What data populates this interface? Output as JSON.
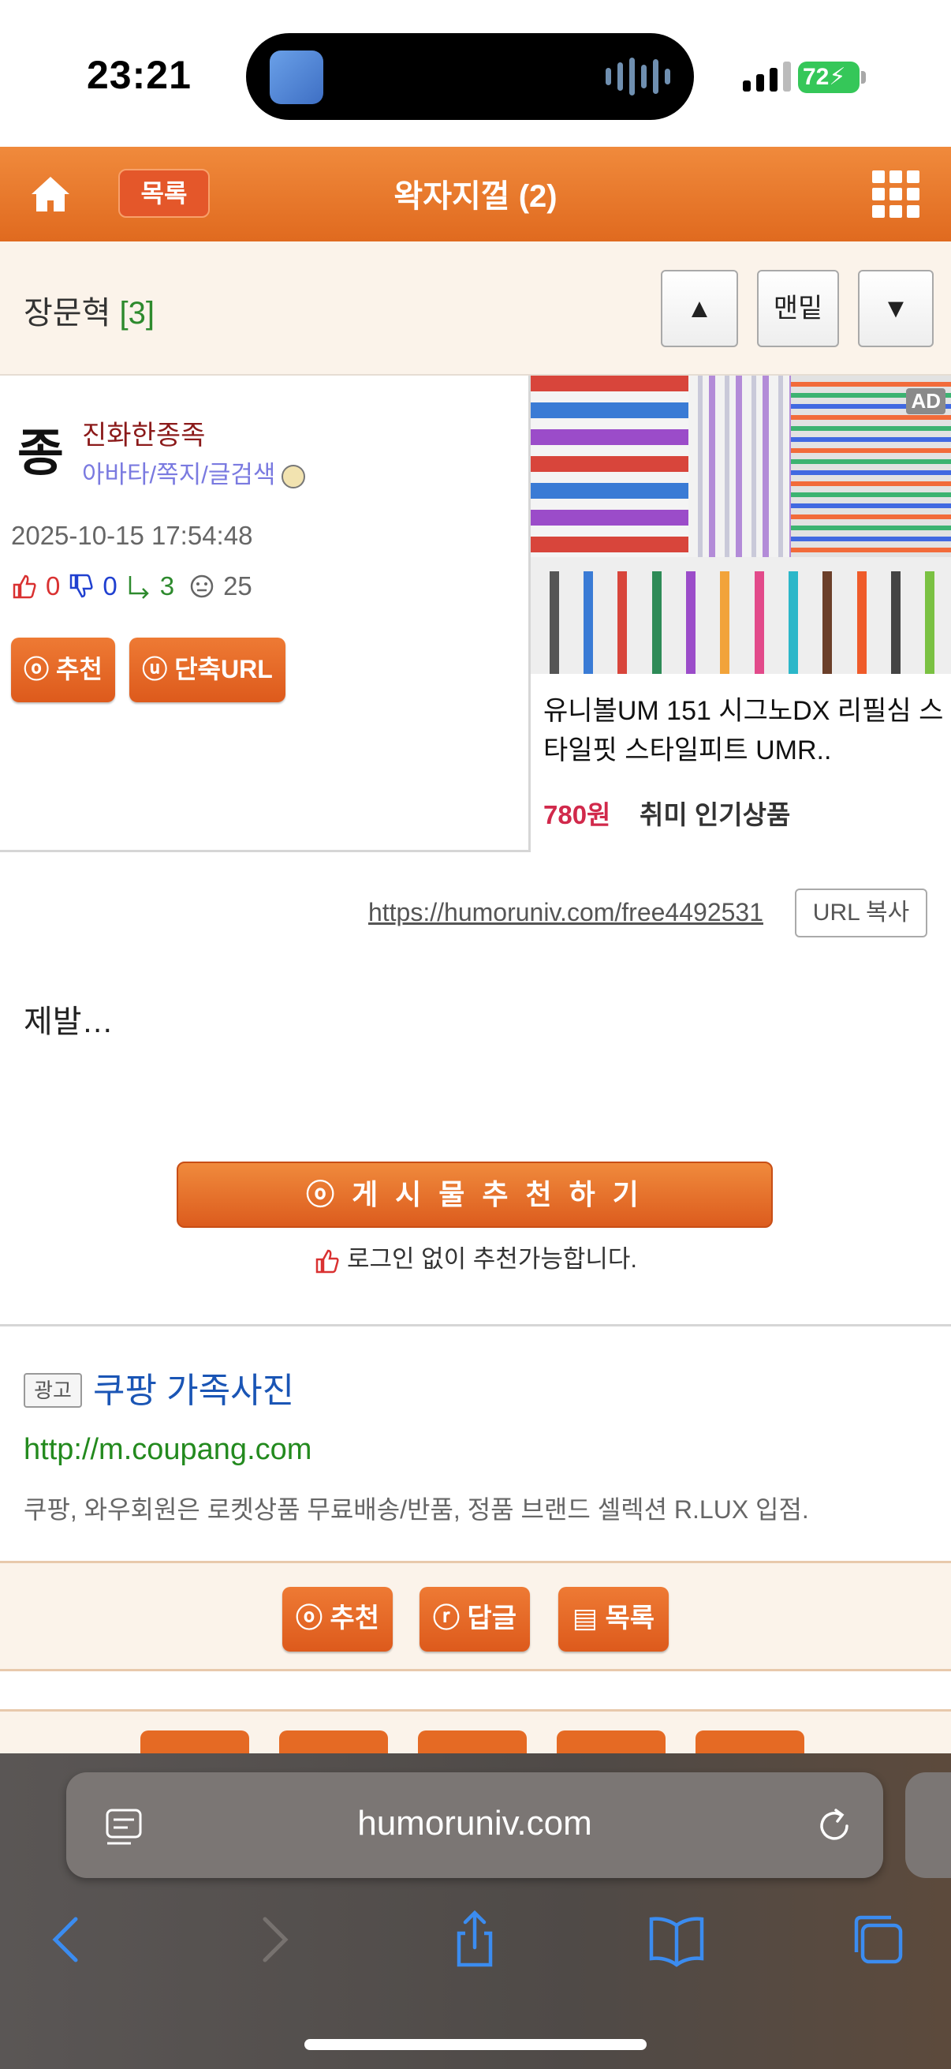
{
  "status": {
    "time": "23:21",
    "battery": "72"
  },
  "nav": {
    "list_label": "목록",
    "title": "왁자지껄 (2)"
  },
  "author_bar": {
    "name": "장문혁",
    "count": "[3]",
    "up": "▲",
    "bottom": "맨밑",
    "down": "▼"
  },
  "post": {
    "avatar_char": "종",
    "nickname": "진화한종족",
    "links": "아바타/쪽지/글검색",
    "date": "2025-10-15 17:54:48",
    "likes": "0",
    "dislikes": "0",
    "replies": "3",
    "views": "25",
    "recommend_btn": "ⓞ 추천",
    "short_url_btn": "ⓤ 단축URL",
    "url": "https://humoruniv.com/free4492531",
    "url_copy": "URL 복사",
    "content": "제발…",
    "recommend_big": "ⓞ 게 시 물   추 천 하 기",
    "login_note": "로그인 없이 추천가능합니다."
  },
  "side_ad": {
    "badge": "AD",
    "title": "유니볼UM 151 시그노DX 리필심 스타일핏 스타일피트 UMR..",
    "price": "780원",
    "category": "취미 인기상품"
  },
  "text_ad": {
    "tag": "광고",
    "headline": "쿠팡 가족사진",
    "link": "http://m.coupang.com",
    "desc": "쿠팡, 와우회원은 로켓상품 무료배송/반품, 정품 브랜드 셀렉션 R.LUX 입점."
  },
  "actions": {
    "recommend": "ⓞ 추천",
    "reply": "ⓡ 답글",
    "list": "▤ 목록"
  },
  "browser": {
    "url": "humoruniv.com"
  }
}
